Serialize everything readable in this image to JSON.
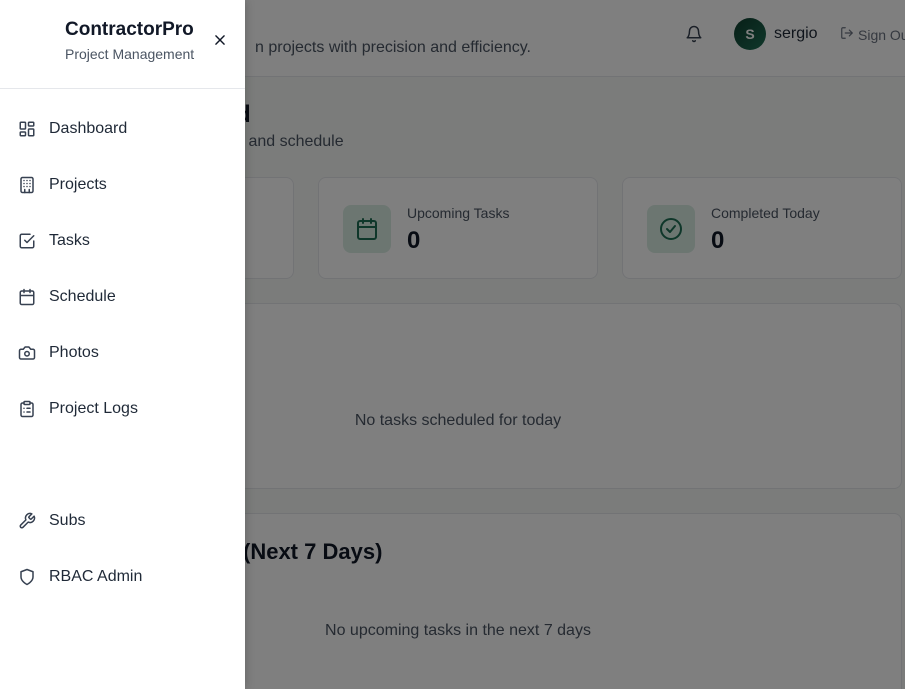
{
  "header": {
    "tagline_visible": "n projects with precision and efficiency.",
    "username": "sergio",
    "avatar_initial": "S",
    "signout_label": "Sign Ou",
    "bell_icon": "bell-icon",
    "signout_icon": "logout-icon"
  },
  "dashboard": {
    "title_visible": "d",
    "subtitle_visible": "s and schedule",
    "stats": [
      {
        "label": "Upcoming Tasks",
        "value": "0",
        "icon": "calendar-icon"
      },
      {
        "label": "Completed Today",
        "value": "0",
        "icon": "check-circle-icon"
      }
    ],
    "today_empty": "No tasks scheduled for today",
    "upcoming_title_visible": "(Next 7 Days)",
    "upcoming_empty": "No upcoming tasks in the next 7 days"
  },
  "sidebar": {
    "brand_title": "ContractorPro",
    "brand_subtitle": "Project Management",
    "close_icon": "close-icon",
    "items": [
      {
        "label": "Dashboard",
        "icon": "layout-dashboard-icon"
      },
      {
        "label": "Projects",
        "icon": "building-icon"
      },
      {
        "label": "Tasks",
        "icon": "check-square-icon"
      },
      {
        "label": "Schedule",
        "icon": "calendar-icon"
      },
      {
        "label": "Photos",
        "icon": "camera-icon"
      },
      {
        "label": "Project Logs",
        "icon": "clipboard-list-icon"
      },
      {
        "label": "Subs",
        "icon": "wrench-icon"
      },
      {
        "label": "RBAC Admin",
        "icon": "shield-icon"
      }
    ]
  },
  "colors": {
    "accent": "#1f6f55",
    "accent_soft": "#d9ede3",
    "overlay": "rgba(0,0,0,0.5)"
  }
}
